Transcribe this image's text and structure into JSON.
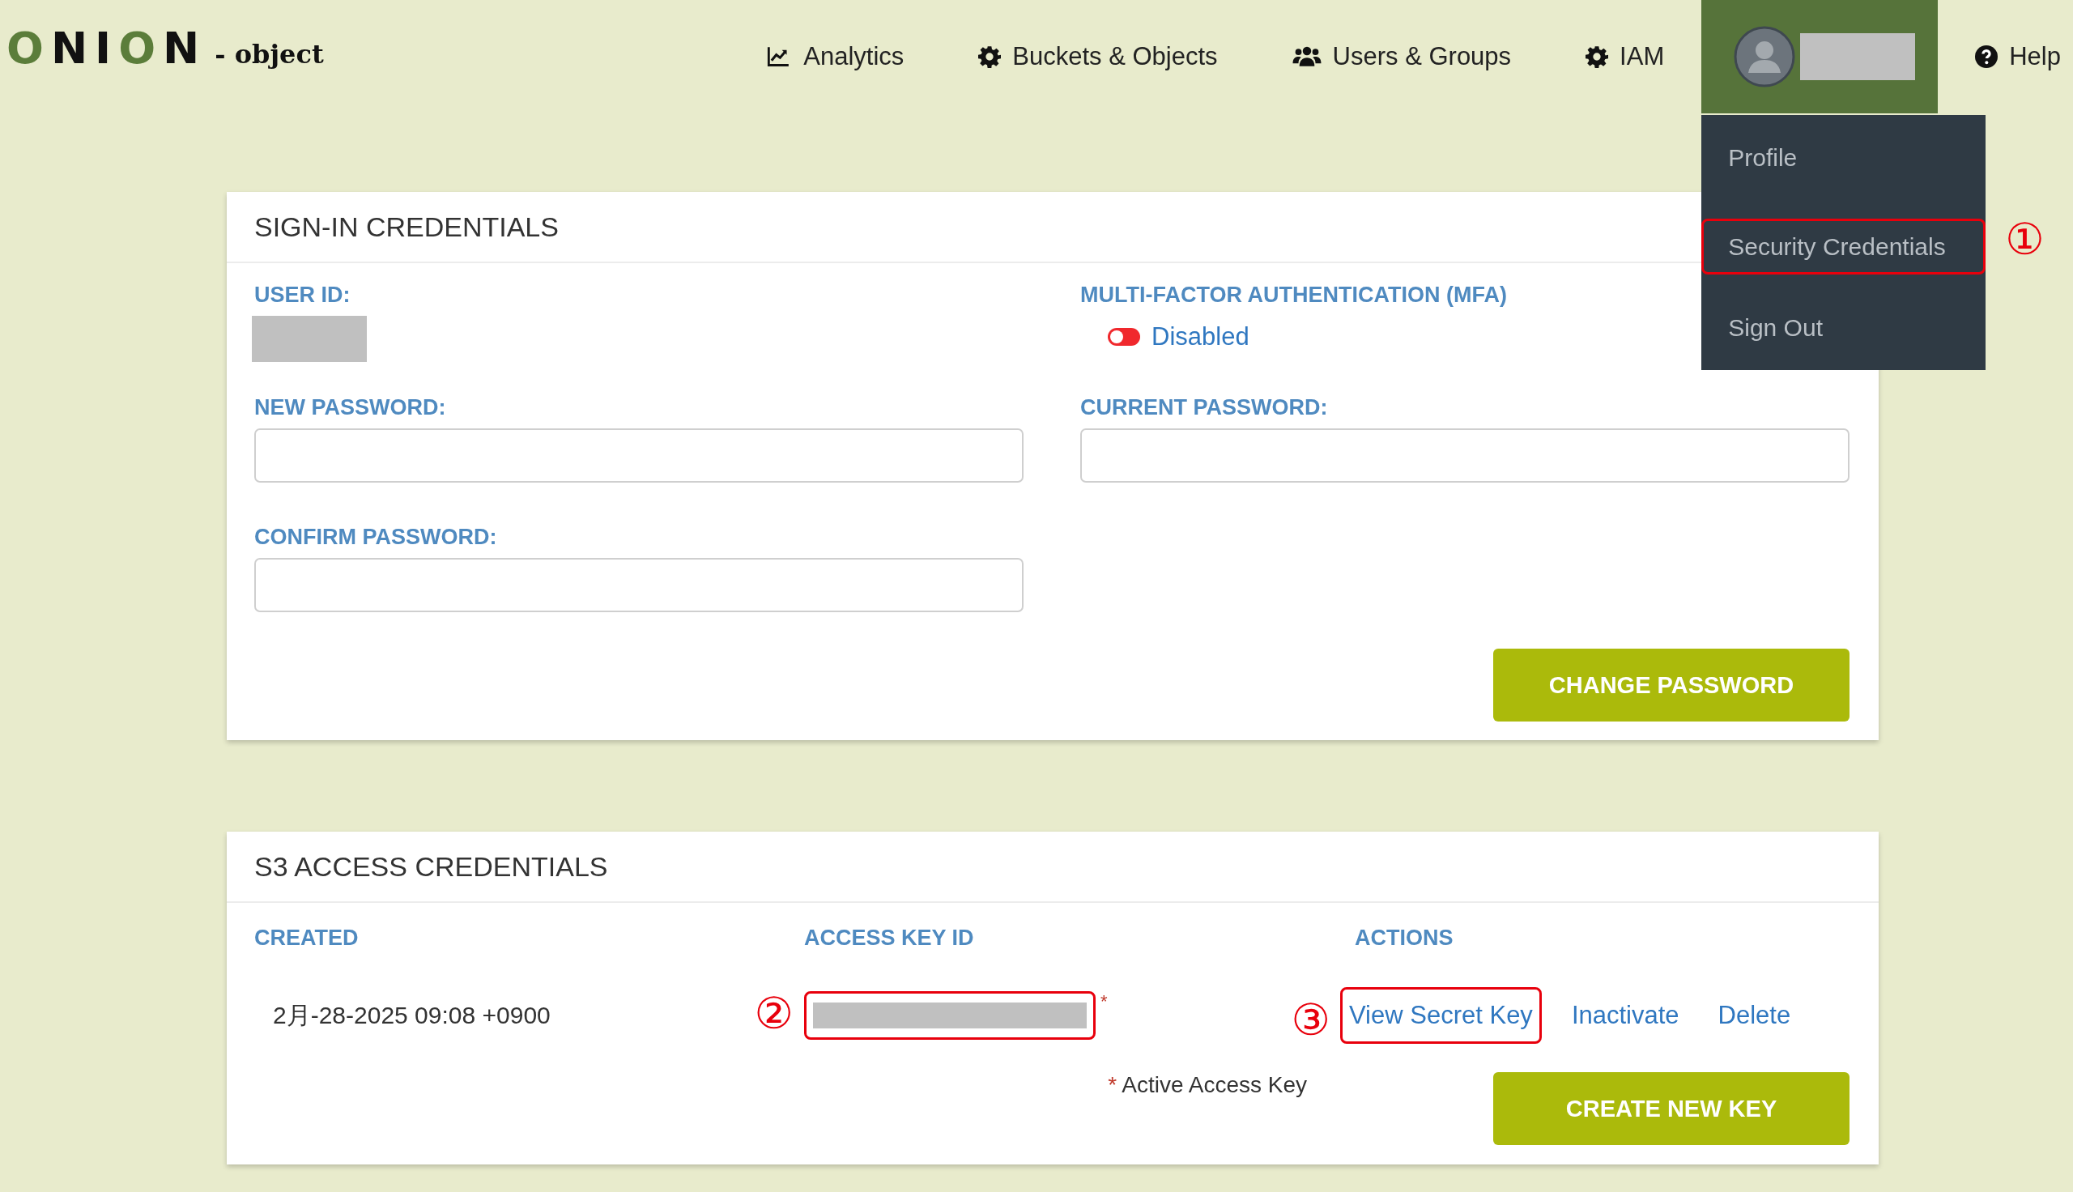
{
  "logo": {
    "letters": [
      {
        "text": "O",
        "color": "#5b7d3a"
      },
      {
        "text": "N",
        "color": "#111111"
      },
      {
        "text": "I",
        "color": "#111111"
      },
      {
        "text": "O",
        "color": "#5b7d3a"
      },
      {
        "text": "N",
        "color": "#111111"
      }
    ],
    "suffix": "- object"
  },
  "nav": {
    "items": [
      {
        "label": "Analytics",
        "kind": "chart"
      },
      {
        "label": "Buckets & Objects",
        "kind": "gear"
      },
      {
        "label": "Users & Groups",
        "kind": "users"
      },
      {
        "label": "IAM",
        "kind": "gear"
      }
    ],
    "help": {
      "label": "Help",
      "kind": "help"
    }
  },
  "user_menu": {
    "items": [
      {
        "label": "Profile"
      },
      {
        "label": "Security Credentials",
        "marker": "①"
      },
      {
        "label": "Sign Out"
      }
    ]
  },
  "sign_in": {
    "title": "SIGN-IN CREDENTIALS",
    "user_id": {
      "label": "USER ID:"
    },
    "mfa": {
      "label": "MULTI-FACTOR AUTHENTICATION (MFA)",
      "on": false,
      "status": "Disabled"
    },
    "fields": [
      {
        "label": "NEW PASSWORD:"
      },
      {
        "label": "CURRENT PASSWORD:"
      },
      {
        "label": "CONFIRM PASSWORD:"
      }
    ],
    "button": "CHANGE PASSWORD"
  },
  "s3": {
    "title": "S3 ACCESS CREDENTIALS",
    "columns": [
      "CREATED",
      "ACCESS KEY ID",
      "ACTIONS"
    ],
    "rows": [
      {
        "created": "2月-28-2025 09:08 +0900",
        "access_key": {
          "marker": "②"
        },
        "active_mark": "*",
        "actions": [
          {
            "label": "View Secret Key",
            "marker": "③"
          },
          {
            "label": "Inactivate"
          },
          {
            "label": "Delete"
          }
        ]
      }
    ],
    "footnote": {
      "mark": "*",
      "text": "Active Access Key"
    },
    "button": "CREATE NEW KEY"
  }
}
